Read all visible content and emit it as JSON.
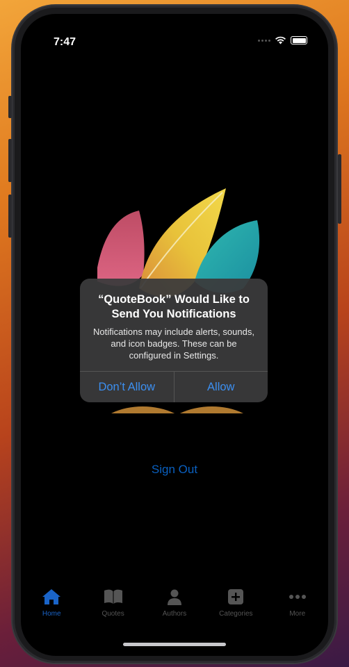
{
  "status": {
    "time": "7:47"
  },
  "main": {
    "sign_out_label": "Sign Out"
  },
  "alert": {
    "title": "“QuoteBook” Would Like to Send You Notifications",
    "message": "Notifications may include alerts, sounds, and icon badges. These can be configured in Settings.",
    "deny_label": "Don’t Allow",
    "allow_label": "Allow"
  },
  "tabbar": {
    "tabs": [
      {
        "label": "Home",
        "icon": "home-icon",
        "active": true
      },
      {
        "label": "Quotes",
        "icon": "book-icon",
        "active": false
      },
      {
        "label": "Authors",
        "icon": "person-icon",
        "active": false
      },
      {
        "label": "Categories",
        "icon": "plus-square-icon",
        "active": false
      },
      {
        "label": "More",
        "icon": "ellipsis-icon",
        "active": false
      }
    ]
  },
  "colors": {
    "accent": "#1a64c8",
    "alert_button": "#3c8ff0",
    "inactive_tab": "#555555"
  }
}
